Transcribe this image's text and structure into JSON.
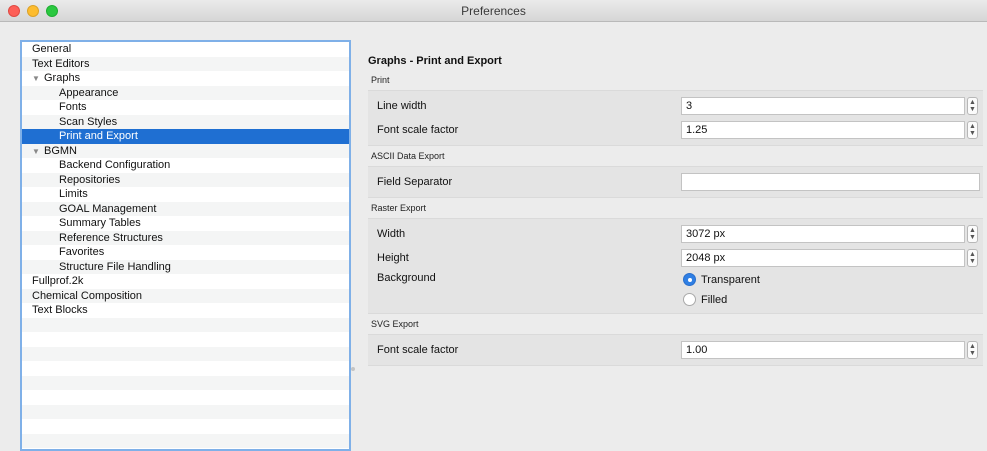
{
  "window": {
    "title": "Preferences"
  },
  "tree": {
    "items": [
      {
        "label": "General",
        "level": 0
      },
      {
        "label": "Text Editors",
        "level": 0
      },
      {
        "label": "Graphs",
        "level": 0,
        "expanded": true
      },
      {
        "label": "Appearance",
        "level": 1
      },
      {
        "label": "Fonts",
        "level": 1
      },
      {
        "label": "Scan Styles",
        "level": 1
      },
      {
        "label": "Print and Export",
        "level": 1,
        "selected": true
      },
      {
        "label": "BGMN",
        "level": 0,
        "expanded": true
      },
      {
        "label": "Backend Configuration",
        "level": 1
      },
      {
        "label": "Repositories",
        "level": 1
      },
      {
        "label": "Limits",
        "level": 1
      },
      {
        "label": "GOAL Management",
        "level": 1
      },
      {
        "label": "Summary Tables",
        "level": 1
      },
      {
        "label": "Reference Structures",
        "level": 1
      },
      {
        "label": "Favorites",
        "level": 1
      },
      {
        "label": "Structure File Handling",
        "level": 1
      },
      {
        "label": "Fullprof.2k",
        "level": 0
      },
      {
        "label": "Chemical Composition",
        "level": 0
      },
      {
        "label": "Text Blocks",
        "level": 0
      }
    ]
  },
  "panel": {
    "title": "Graphs - Print and Export",
    "print": {
      "heading": "Print",
      "line_width_label": "Line width",
      "line_width_value": "3",
      "font_scale_label": "Font scale factor",
      "font_scale_value": "1.25"
    },
    "ascii": {
      "heading": "ASCII Data Export",
      "field_separator_label": "Field Separator",
      "field_separator_value": ""
    },
    "raster": {
      "heading": "Raster Export",
      "width_label": "Width",
      "width_value": "3072 px",
      "height_label": "Height",
      "height_value": "2048 px",
      "background_label": "Background",
      "background_options": [
        "Transparent",
        "Filled"
      ],
      "background_selected": "Transparent"
    },
    "svg": {
      "heading": "SVG Export",
      "font_scale_label": "Font scale factor",
      "font_scale_value": "1.00"
    }
  },
  "colors": {
    "selection": "#1f6fd2",
    "focus_ring": "#7fb0e8",
    "radio_on": "#2f7fe4"
  }
}
